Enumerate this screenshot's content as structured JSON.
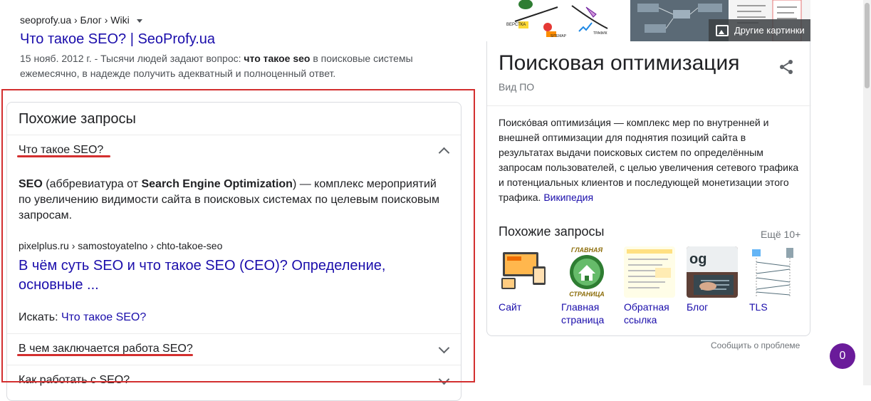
{
  "result": {
    "breadcrumb": "seoprofy.ua › Блог › Wiki",
    "title": "Что такое SEO? | SeoProfy.ua",
    "date": "15 нояб. 2012 г. -",
    "snippet_pre": " Тысячи людей задают вопрос: ",
    "snippet_bold": "что такое seo",
    "snippet_post": " в поисковые системы ежемесячно, в надежде получить адекватный и полноценный ответ."
  },
  "people_also_ask": {
    "heading": "Похожие запросы",
    "questions": [
      {
        "text": "Что такое SEO?",
        "expanded": true
      },
      {
        "text": "В чем заключается работа SEO?",
        "expanded": false
      },
      {
        "text": "Как работать с SEO?",
        "expanded": false
      }
    ],
    "answer": {
      "bold1": "SEO",
      "text1": " (аббревиатура от ",
      "bold2": "Search Engine Optimization",
      "text2": ") — комплекс мероприятий по увеличению видимости сайта в поисковых системах по целевым поисковым запросам.",
      "breadcrumb": "pixelplus.ru › samostoyatelno › chto-takoe-seo",
      "title": "В чём суть SEO и что такое SEO (СЕО)? Определение, основные ...",
      "search_label": "Искать: ",
      "search_link": "Что такое SEO?"
    }
  },
  "knowledge_panel": {
    "more_images": "Другие картинки",
    "title": "Поисковая оптимизация",
    "subtitle": "Вид ПО",
    "description": "Поиско́вая оптимиза́ция — комплекс мер по внутренней и внешней оптимизации для поднятия позиций сайта в результатах выдачи поисковых систем по определённым запросам пользователей, с целью увеличения сетевого трафика и потенциальных клиентов и последующей монетизации этого трафика. ",
    "description_link": "Википедия",
    "related_heading": "Похожие запросы",
    "related_more": "Ещё 10+",
    "related": [
      {
        "label": "Сайт"
      },
      {
        "label": "Главная страница"
      },
      {
        "label": "Обратная ссылка"
      },
      {
        "label": "Блог"
      },
      {
        "label": "TLS"
      }
    ]
  },
  "report_link": "Сообщить о проблеме",
  "chat_badge": "0",
  "colors": {
    "link": "#1a0dab",
    "highlight": "#d32f2f",
    "badge": "#6a1b9a"
  }
}
